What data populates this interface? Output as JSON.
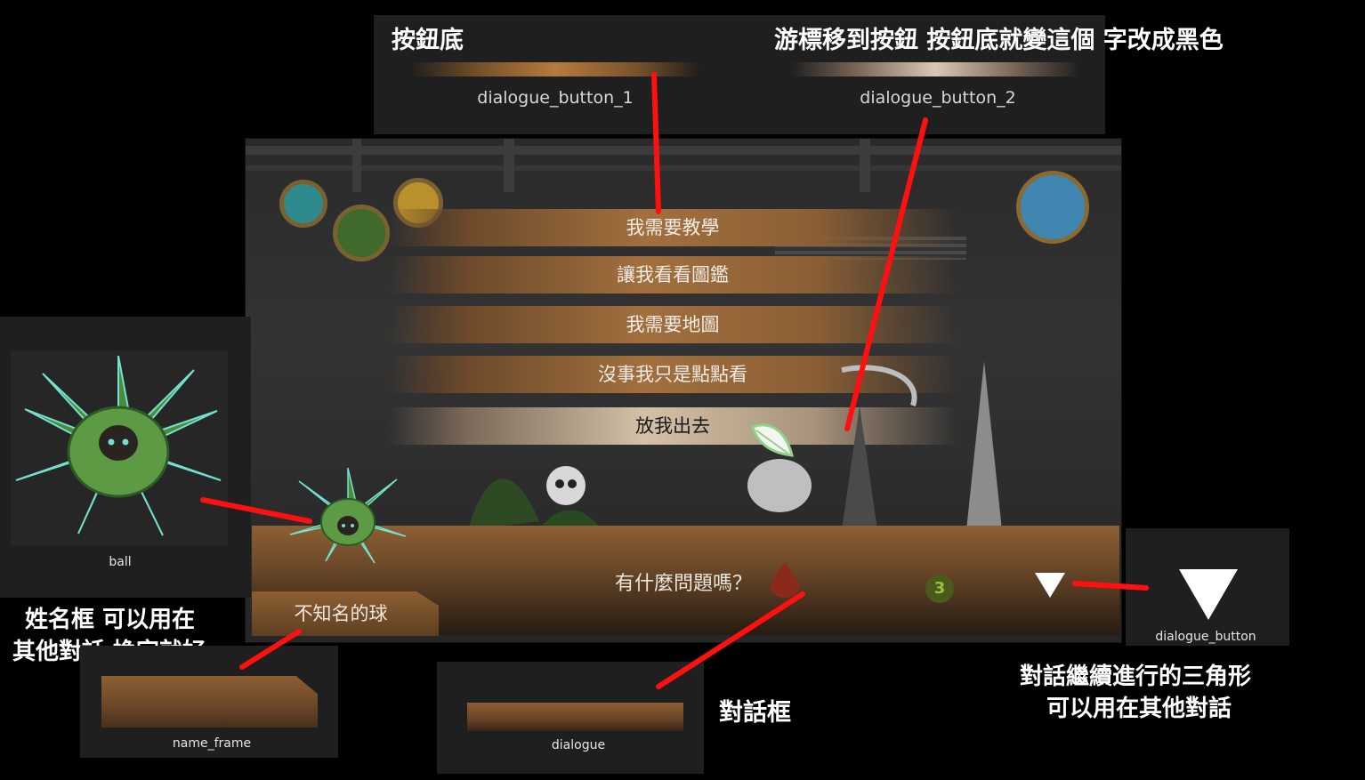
{
  "annotations": {
    "button_base": "按鈕底",
    "hover_note": "游標移到按鈕 按鈕底就變這個 字改成黑色",
    "name_frame_note_line1": "姓名框 可以用在",
    "name_frame_note_line2": "其他對話 換字就好",
    "dialogue_note": "對話框",
    "triangle_note_line1": "對話繼續進行的三角形",
    "triangle_note_line2": "可以用在其他對話"
  },
  "assets": {
    "button_1": "dialogue_button_1",
    "button_2": "dialogue_button_2",
    "ball": "ball",
    "name_frame": "name_frame",
    "dialogue": "dialogue",
    "dialogue_button": "dialogue_button"
  },
  "game": {
    "menu": [
      {
        "label": "我需要教學"
      },
      {
        "label": "讓我看看圖鑑"
      },
      {
        "label": "我需要地圖"
      },
      {
        "label": "沒事我只是點點看"
      },
      {
        "label": "放我出去"
      }
    ],
    "dialogue_text": "有什麼問題嗎？",
    "speaker_name": "不知名的球",
    "badge_number": "3"
  },
  "colors": {
    "annotation_line": "#ff1010",
    "button_brown": "#a2703f",
    "button_hover": "#d4c1a8",
    "ball_green": "#4d8a3a",
    "ball_glow": "#74e0d0"
  }
}
